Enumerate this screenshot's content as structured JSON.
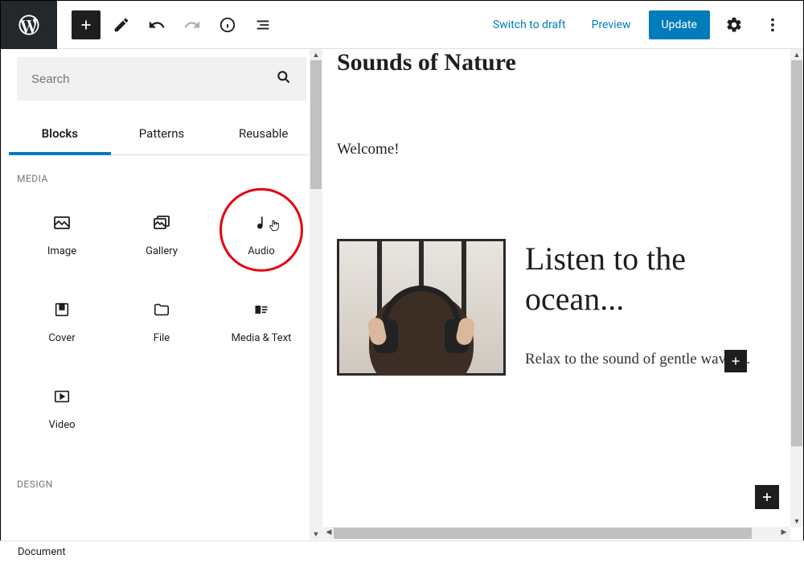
{
  "topbar": {
    "switch_to_draft": "Switch to draft",
    "preview": "Preview",
    "update": "Update"
  },
  "sidebar": {
    "search_placeholder": "Search",
    "tabs": {
      "blocks": "Blocks",
      "patterns": "Patterns",
      "reusable": "Reusable"
    },
    "sections": {
      "media": {
        "title": "MEDIA",
        "blocks": [
          {
            "label": "Image"
          },
          {
            "label": "Gallery"
          },
          {
            "label": "Audio"
          },
          {
            "label": "Cover"
          },
          {
            "label": "File"
          },
          {
            "label": "Media & Text"
          },
          {
            "label": "Video"
          }
        ]
      },
      "design": {
        "title": "DESIGN"
      }
    }
  },
  "canvas": {
    "title": "Sounds of Nature",
    "welcome": "Welcome!",
    "media_text": {
      "heading": "Listen to the ocean...",
      "body": "Relax to the sound of gentle waves..."
    }
  },
  "footer": {
    "document": "Document"
  },
  "colors": {
    "accent": "#007cba",
    "highlight": "#e6000f"
  }
}
